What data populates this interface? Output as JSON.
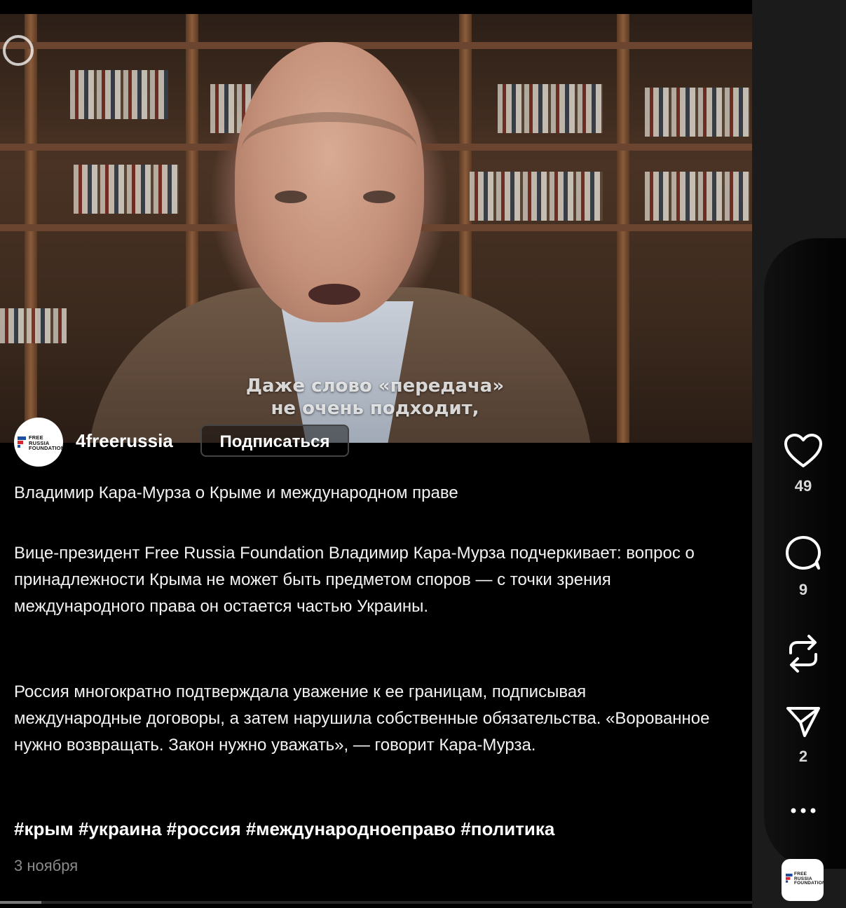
{
  "video": {
    "subtitle_line1": "Даже слово «передача»",
    "subtitle_line2": "не очень подходит,"
  },
  "author": {
    "username": "4freerussia",
    "avatar_text": "FREE\nRUSSIA\nFOUNDATION",
    "follow_label": "Подписаться"
  },
  "post": {
    "title": "Владимир Кара-Мурза о Крыме и международном праве",
    "paragraph1": "Вице-президент Free Russia Foundation Владимир Кара-Мурза подчеркивает: вопрос о принадлежности Крыма не может быть предметом споров — с точки зрения международного права он остается частью Украины.",
    "paragraph2": "Россия многократно подтверждала уважение к ее границам, подписывая международные договоры, а затем нарушила собственные обязательства. «Ворованное нужно возвращать. Закон нужно уважать», — говорит Кара-Мурза.",
    "hashtags": "#крым #украина #россия #международноеправо  #политика",
    "date": "3 ноября"
  },
  "actions": {
    "likes": "49",
    "comments": "9",
    "shares": "2",
    "like_icon": "heart-icon",
    "comment_icon": "comment-icon",
    "repost_icon": "repost-icon",
    "share_icon": "send-icon",
    "more_icon": "more-icon"
  },
  "progress": {
    "fraction": 0.055
  },
  "colors": {
    "background": "#000000",
    "rail": "#1b1b1b",
    "text": "#f3f3f3",
    "muted": "#8b8b8b"
  }
}
